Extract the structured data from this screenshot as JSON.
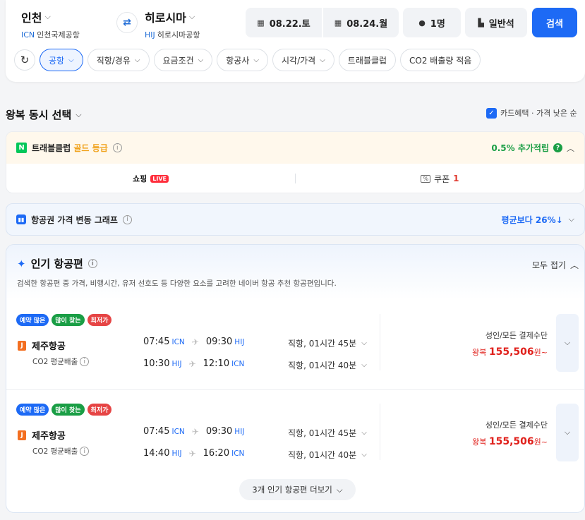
{
  "search": {
    "origin": {
      "name": "인천",
      "code": "ICN",
      "airport": "인천국제공항"
    },
    "destination": {
      "name": "히로시마",
      "code": "HIJ",
      "airport": "히로시마공항"
    },
    "depart_date": "08.22.토",
    "return_date": "08.24.월",
    "passengers": "1명",
    "seat_class": "일반석",
    "search_label": "검색"
  },
  "filters": [
    "공항",
    "직항/경유",
    "요금조건",
    "항공사",
    "시각/가격",
    "트래블클럽",
    "CO2 배출량 적음"
  ],
  "roundtrip": {
    "title": "왕복 동시 선택",
    "sort_label": "카드혜택 · 가격 낮은 순"
  },
  "club": {
    "title": "트래블클럽",
    "grade": "골드 등급",
    "accrual": "0.5% 추가적립",
    "shopping": "쇼핑",
    "live": "LIVE",
    "coupon_label": "쿠폰",
    "coupon_count": "1"
  },
  "graph": {
    "title": "항공권 가격 변동 그래프",
    "compare": "평균보다 26%↓"
  },
  "popular": {
    "title": "인기 항공편",
    "collapse_all": "모두 접기",
    "description": "검색한 항공편 중 가격, 비행시간, 유저 선호도 등 다양한 요소를 고려한 네이버 항공 추천 항공편입니다.",
    "more_label": "3개 인기 항공편 더보기",
    "flights": [
      {
        "tags": [
          "예약 많은",
          "많이 찾는",
          "최저가"
        ],
        "airline": "제주항공",
        "co2": "CO2 평균배출",
        "outbound": {
          "dep_time": "07:45",
          "dep_code": "ICN",
          "arr_time": "09:30",
          "arr_code": "HIJ",
          "duration": "직항, 01시간 45분"
        },
        "inbound": {
          "dep_time": "10:30",
          "dep_code": "HIJ",
          "arr_time": "12:10",
          "arr_code": "ICN",
          "duration": "직항, 01시간 40분"
        },
        "fare_label": "성인/모든 결제수단",
        "price_prefix": "왕복",
        "price": "155,506",
        "price_suffix": "원~"
      },
      {
        "tags": [
          "예약 많은",
          "많이 찾는",
          "최저가"
        ],
        "airline": "제주항공",
        "co2": "CO2 평균배출",
        "outbound": {
          "dep_time": "07:45",
          "dep_code": "ICN",
          "arr_time": "09:30",
          "arr_code": "HIJ",
          "duration": "직항, 01시간 45분"
        },
        "inbound": {
          "dep_time": "14:40",
          "dep_code": "HIJ",
          "arr_time": "16:20",
          "arr_code": "ICN",
          "duration": "직항, 01시간 40분"
        },
        "fare_label": "성인/모든 결제수단",
        "price_prefix": "왕복",
        "price": "155,506",
        "price_suffix": "원~"
      }
    ]
  },
  "colors": {
    "accent": "#1d6af5",
    "price": "#e0201b",
    "green": "#1a9e45",
    "gold": "#f0a21b"
  },
  "icons": [
    "swap-icon",
    "calendar-icon",
    "person-icon",
    "seat-icon",
    "refresh-icon",
    "chevron-down-icon",
    "check-icon",
    "naver-n-icon",
    "info-icon",
    "chart-icon",
    "sparkle-icon",
    "airline-logo-icon",
    "plane-icon"
  ]
}
